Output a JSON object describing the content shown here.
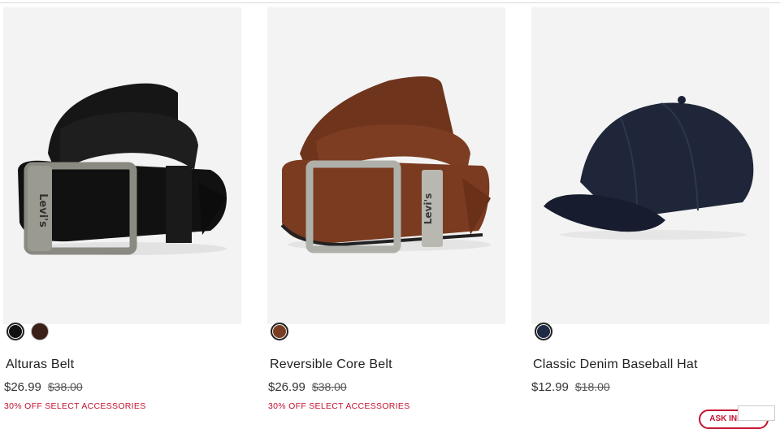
{
  "products": [
    {
      "name": "Alturas Belt",
      "sale_price": "$26.99",
      "original_price": "$38.00",
      "promo": "30% OFF SELECT ACCESSORIES",
      "brand_mark": "Levi's",
      "swatches": [
        {
          "color": "#111111",
          "selected": true
        },
        {
          "color": "#3a2018",
          "selected": false
        }
      ]
    },
    {
      "name": "Reversible Core Belt",
      "sale_price": "$26.99",
      "original_price": "$38.00",
      "promo": "30% OFF SELECT ACCESSORIES",
      "brand_mark": "Levi's",
      "swatches": [
        {
          "color": "#7a3d24",
          "selected": true
        }
      ]
    },
    {
      "name": "Classic Denim Baseball Hat",
      "sale_price": "$12.99",
      "original_price": "$18.00",
      "promo": "",
      "swatches": [
        {
          "color": "#1f2a44",
          "selected": true
        }
      ]
    }
  ],
  "chat": {
    "label": "ASK INDIGO"
  },
  "colors": {
    "accent": "#c41230",
    "image_bg": "#f3f3f3"
  }
}
